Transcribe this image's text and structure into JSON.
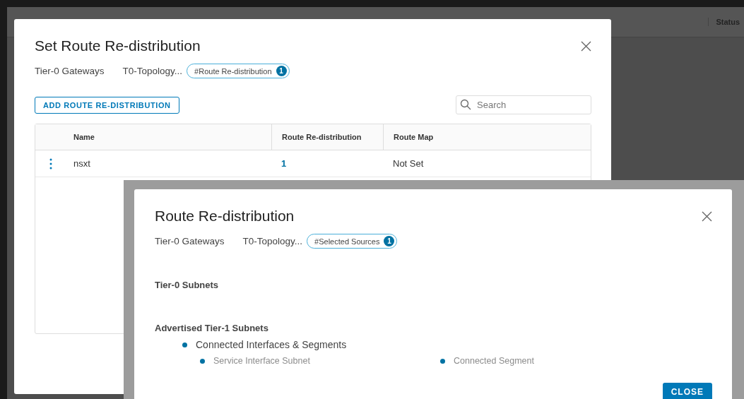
{
  "background": {
    "column_header": "Status"
  },
  "dialog": {
    "title": "Set Route Re-distribution",
    "breadcrumb": [
      "Tier-0 Gateways",
      "T0-Topology..."
    ],
    "badge": {
      "label": "#Route Re-distribution",
      "count": "1"
    },
    "add_button": "ADD ROUTE RE-DISTRIBUTION",
    "search": {
      "placeholder": "Search"
    },
    "table": {
      "columns": [
        "Name",
        "Route Re-distribution",
        "Route Map"
      ],
      "rows": [
        {
          "name": "nsxt",
          "route_redistribution": "1",
          "route_map": "Not Set"
        }
      ]
    }
  },
  "subdialog": {
    "title": "Route Re-distribution",
    "breadcrumb": [
      "Tier-0 Gateways",
      "T0-Topology..."
    ],
    "badge": {
      "label": "#Selected Sources",
      "count": "1"
    },
    "sections": [
      {
        "heading": "Tier-0 Subnets"
      },
      {
        "heading": "Advertised Tier-1 Subnets",
        "items": [
          {
            "label": "Connected Interfaces & Segments",
            "children": [
              {
                "label": "Service Interface Subnet"
              },
              {
                "label": "Connected Segment"
              }
            ]
          }
        ]
      }
    ],
    "close_button": "CLOSE"
  }
}
